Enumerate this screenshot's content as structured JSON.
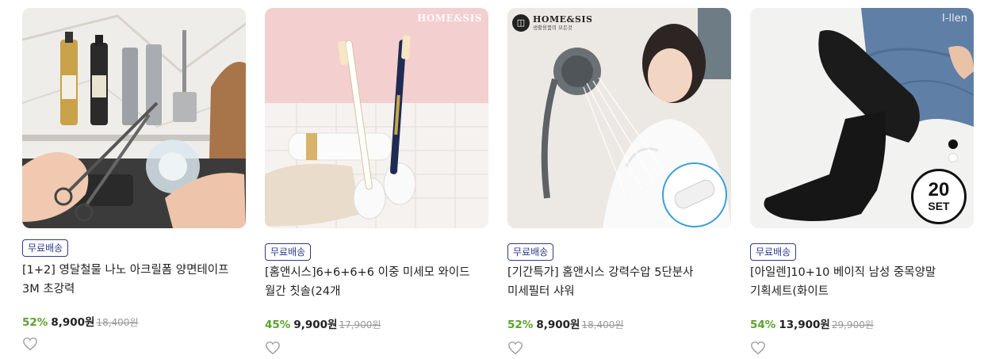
{
  "products": [
    {
      "badge": "무료배송",
      "title": "[1+2] 영달철물 나노 아크릴폼 양면테이프 3M 초강력",
      "discount": "52%",
      "price": "8,900원",
      "original_price": "18,400원",
      "image_label": "double-sided tape on kitchen wall"
    },
    {
      "badge": "무료배송",
      "title": "[홈앤시스]6+6+6+6 이중 미세모 와이드 월간 칫솔(24개",
      "discount": "45%",
      "price": "9,900원",
      "original_price": "17,900원",
      "brand_watermark": "HOME&SIS",
      "image_label": "toothbrushes in holders"
    },
    {
      "badge": "무료배송",
      "title": "[기간특가] 홈앤시스 강력수압 5단분사 미세필터 샤워",
      "discount": "52%",
      "price": "8,900원",
      "original_price": "18,400원",
      "brand_logo": "HOME&SIS",
      "brand_tagline": "생활용품의 모든것",
      "image_label": "woman using shower head"
    },
    {
      "badge": "무료배송",
      "title": "[아일렌]10+10 베이직 남성 중목양말 기획세트(화이트",
      "discount": "54%",
      "price": "13,900원",
      "original_price": "29,900원",
      "brand_watermark": "I-llen",
      "set_count": "20",
      "set_label": "SET",
      "image_label": "black socks on crossed legs"
    }
  ],
  "colors": {
    "badge": "#2f3a8f",
    "discount": "#5aa12a",
    "original_price": "#999999"
  },
  "icons": {
    "wishlist": "heart-outline-icon"
  }
}
